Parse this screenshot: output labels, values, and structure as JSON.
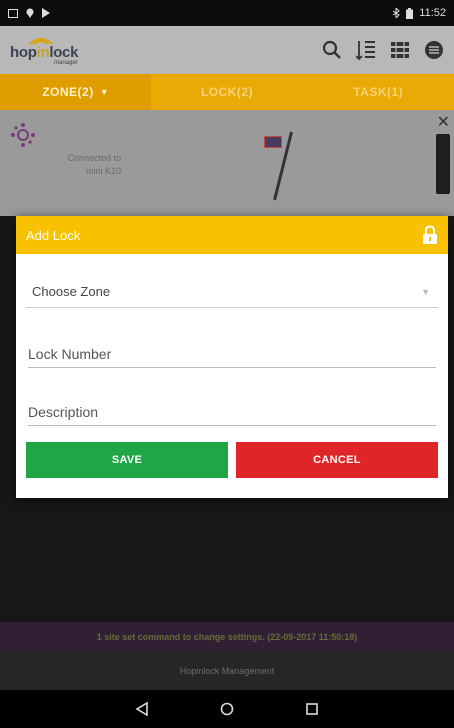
{
  "status_bar": {
    "time": "11:52"
  },
  "header": {
    "logo_hop": "hop",
    "logo_in": "in",
    "logo_lock": "lock",
    "logo_sub": "manager"
  },
  "tabs": [
    {
      "label": "ZONE(2)",
      "active": true
    },
    {
      "label": "LOCK(2)",
      "active": false
    },
    {
      "label": "TASK(1)",
      "active": false
    }
  ],
  "device": {
    "connected_line1": "Connected to",
    "connected_line2": "mini K10"
  },
  "dialog": {
    "title": "Add Lock",
    "zone_placeholder": "Choose Zone",
    "lock_number_placeholder": "Lock Number",
    "description_placeholder": "Description",
    "save_label": "SAVE",
    "cancel_label": "CANCEL"
  },
  "notice": "1 site set command to change settings. (22-09-2017 11:50:18)",
  "footer": "Hopinlock Management",
  "colors": {
    "accent": "#f9c200",
    "tab_bg": "#e9aa05",
    "save": "#20a745",
    "cancel": "#df2528"
  }
}
